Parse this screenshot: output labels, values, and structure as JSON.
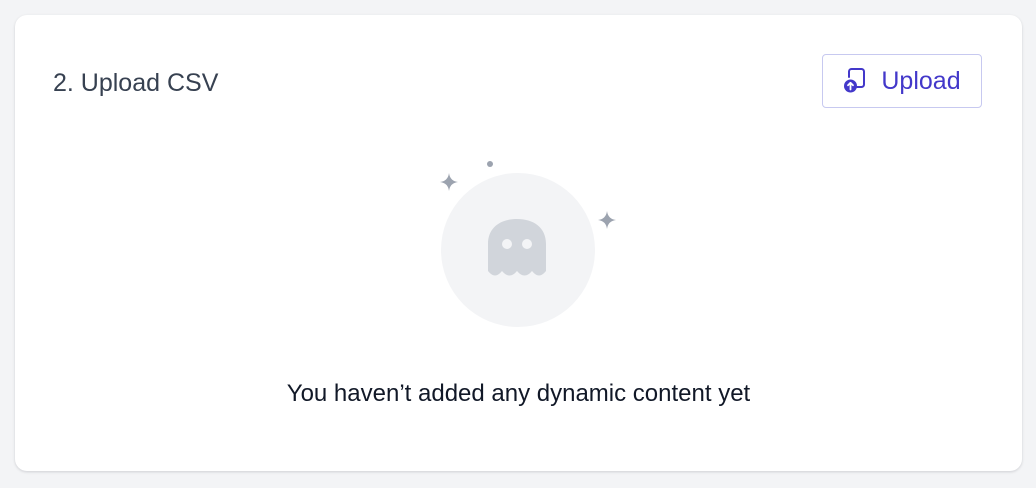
{
  "section": {
    "title": "2. Upload CSV"
  },
  "upload_button": {
    "label": "Upload",
    "icon": "file-upload-icon"
  },
  "empty_state": {
    "icon": "ghost-icon",
    "message": "You haven’t added any dynamic content yet"
  },
  "colors": {
    "page_background": "#f3f4f6",
    "card_background": "#ffffff",
    "accent": "#4338ca",
    "button_border": "#c7c9f0",
    "title_text": "#374151",
    "body_text": "#111827",
    "illustration_circle": "#f3f4f6",
    "ghost": "#d1d5db",
    "sparkle": "#9ca3af"
  }
}
